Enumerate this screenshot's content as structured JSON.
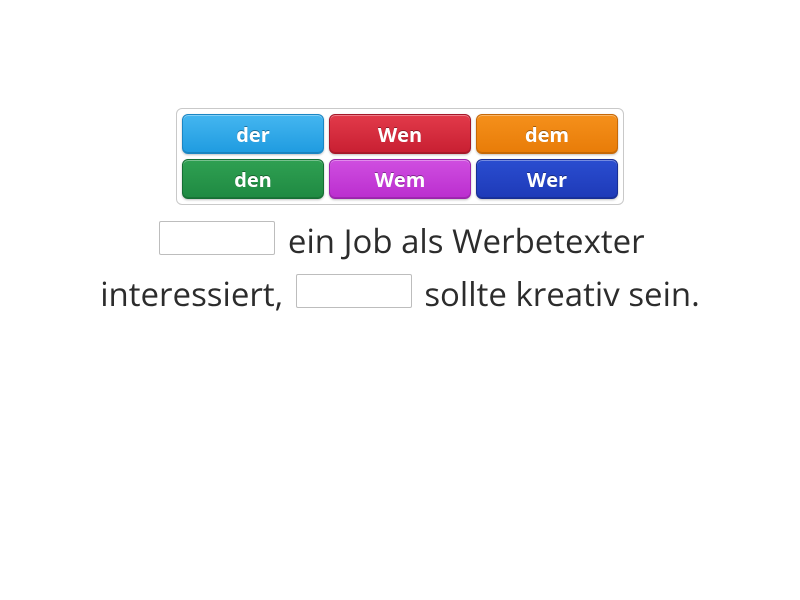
{
  "tiles": {
    "row1": [
      {
        "label": "der",
        "color": "c-blue"
      },
      {
        "label": "Wen",
        "color": "c-red"
      },
      {
        "label": "dem",
        "color": "c-orange"
      }
    ],
    "row2": [
      {
        "label": "den",
        "color": "c-green"
      },
      {
        "label": "Wem",
        "color": "c-magenta"
      },
      {
        "label": "Wer",
        "color": "c-dblue"
      }
    ]
  },
  "sentence": {
    "line1": {
      "w1": "ein",
      "w2": "Job",
      "w3": "als",
      "w4": "Werbetexter"
    },
    "line2": {
      "w1": "interessiert,",
      "w2": "sollte",
      "w3": "kreativ",
      "w4": "sein."
    }
  }
}
